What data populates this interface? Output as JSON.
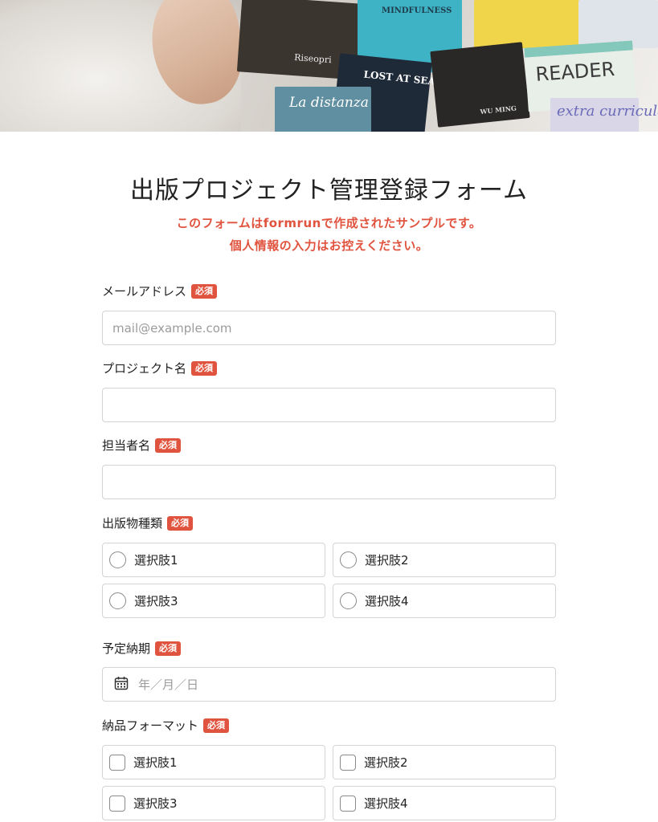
{
  "form": {
    "title": "出版プロジェクト管理登録フォーム",
    "notice_line1": "このフォームはformrunで作成されたサンプルです。",
    "notice_line2": "個人情報の入力はお控えください。",
    "required_label": "必須",
    "accent_color": "#e0533e"
  },
  "hero": {
    "magazine_titles": [
      "La distanza",
      "LOST AT SEA",
      "MINDFULNESS",
      "READER",
      "extra curricular",
      "WU MING",
      "Riseopri"
    ]
  },
  "fields": {
    "email": {
      "label": "メールアドレス",
      "placeholder": "mail@example.com",
      "value": ""
    },
    "project_name": {
      "label": "プロジェクト名",
      "value": ""
    },
    "manager_name": {
      "label": "担当者名",
      "value": ""
    },
    "publication_type": {
      "label": "出版物種類",
      "type": "radio",
      "options": [
        "選択肢1",
        "選択肢2",
        "選択肢3",
        "選択肢4"
      ]
    },
    "due_date": {
      "label": "予定納期",
      "placeholder": "年／月／日",
      "icon": "calendar-icon"
    },
    "delivery_format": {
      "label": "納品フォーマット",
      "type": "checkbox",
      "options": [
        "選択肢1",
        "選択肢2",
        "選択肢3",
        "選択肢4"
      ]
    }
  }
}
